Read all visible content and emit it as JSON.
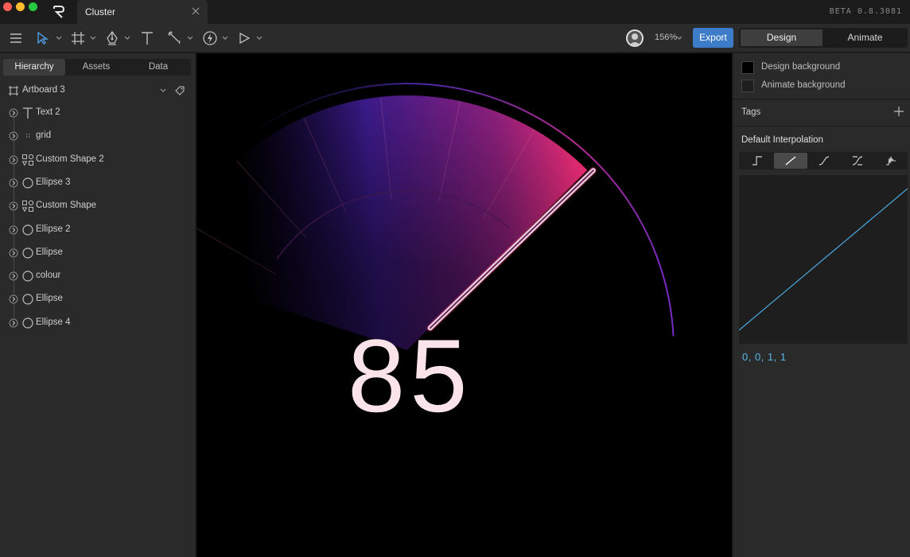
{
  "window": {
    "doc_tab_title": "Cluster",
    "version": "BETA 0.8.3081",
    "icons": {
      "logo": "rive-logo-icon",
      "close": "close-icon"
    }
  },
  "toolbar": {
    "zoom": "156%",
    "export_label": "Export",
    "modes": {
      "design": "Design",
      "animate": "Animate",
      "active": "Design"
    },
    "tools": [
      "menu-icon",
      "select-icon",
      "artboard-icon",
      "pen-icon",
      "text-icon",
      "bone-icon",
      "lightning-icon",
      "play-icon"
    ]
  },
  "left_panel": {
    "tabs": [
      {
        "label": "Hierarchy",
        "active": true
      },
      {
        "label": "Assets",
        "active": false
      },
      {
        "label": "Data",
        "active": false
      }
    ],
    "artboard": {
      "label": "Artboard 3",
      "icon": "artboard-icon"
    },
    "items": [
      {
        "label": "Text 2",
        "icon": "text-icon"
      },
      {
        "label": "grid",
        "icon": "grid-icon"
      },
      {
        "label": "Custom Shape 2",
        "icon": "shapes-icon"
      },
      {
        "label": "Ellipse 3",
        "icon": "ellipse-icon"
      },
      {
        "label": "Custom Shape",
        "icon": "shapes-icon"
      },
      {
        "label": "Ellipse 2",
        "icon": "ellipse-icon"
      },
      {
        "label": "Ellipse",
        "icon": "ellipse-icon"
      },
      {
        "label": "colour",
        "icon": "ellipse-icon"
      },
      {
        "label": "Ellipse",
        "icon": "ellipse-icon"
      },
      {
        "label": "Ellipse 4",
        "icon": "ellipse-icon"
      }
    ]
  },
  "canvas": {
    "gauge_value": "85",
    "colors": {
      "accent_pink": "#ff3c78",
      "accent_purple": "#7a2cff",
      "needle": "#f4d8e6"
    }
  },
  "right_panel": {
    "design_background": "Design background",
    "animate_background": "Animate background",
    "design_bg_color": "#000000",
    "animate_bg_color": "#1e1e1e",
    "tags_label": "Tags",
    "interpolation_title": "Default Interpolation",
    "interpolation_options": [
      "hold-icon",
      "linear-icon",
      "cubic-icon",
      "cubic-custom-icon",
      "elastic-icon"
    ],
    "interpolation_selected": "linear-icon",
    "curve_values": "0, 0, 1, 1",
    "curve_color": "#4aa8e0"
  }
}
